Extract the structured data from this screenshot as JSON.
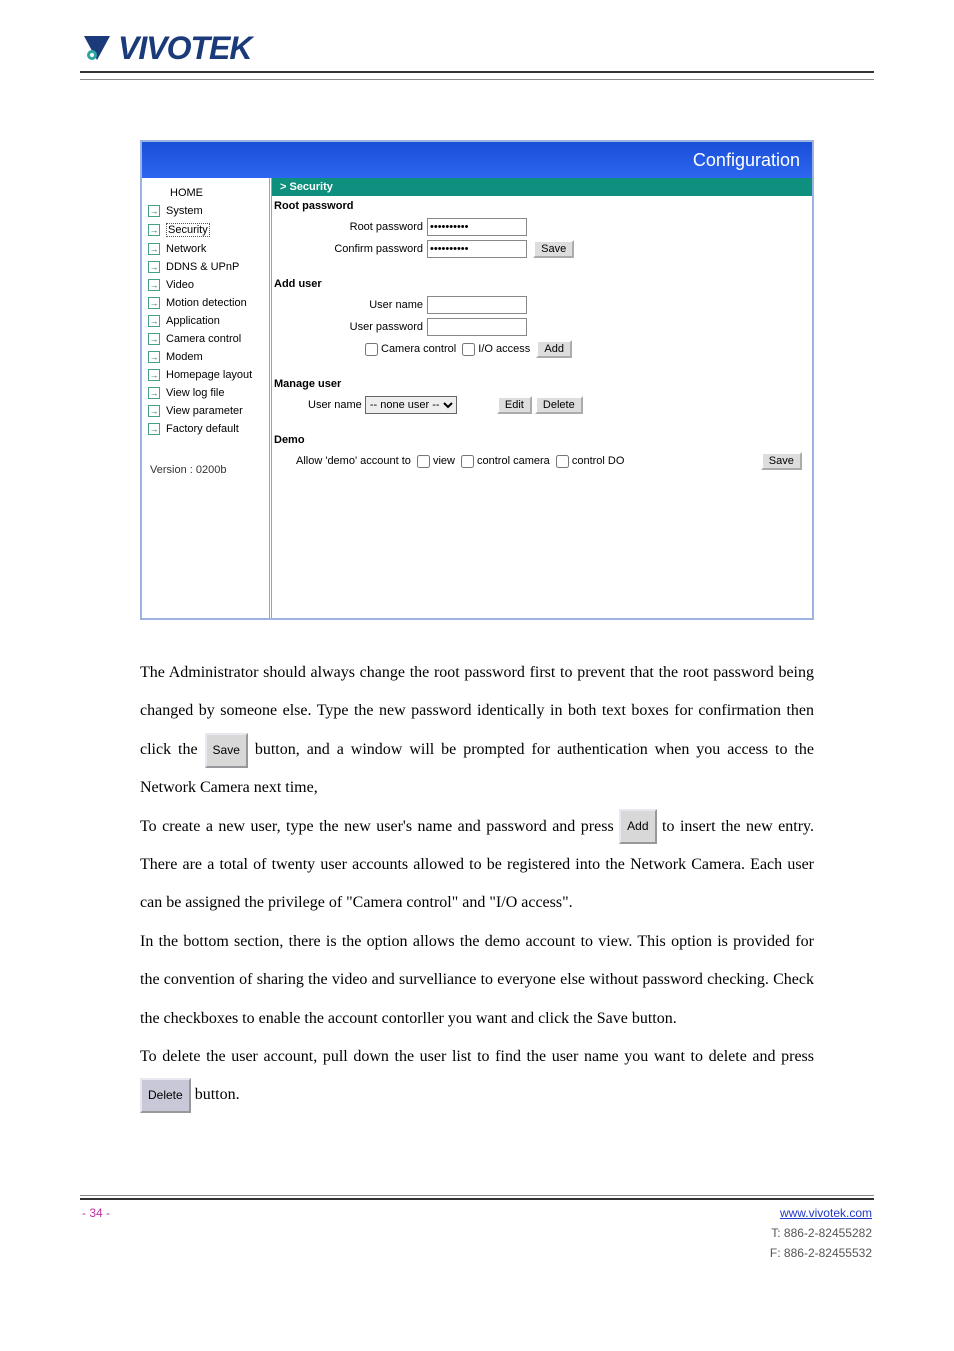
{
  "logo_text": "VIVOTEK",
  "window": {
    "title": "Configuration",
    "sidebar": {
      "home": "HOME",
      "items": [
        "System",
        "Security",
        "Network",
        "DDNS & UPnP",
        "Video",
        "Motion detection",
        "Application",
        "Camera control",
        "Modem",
        "Homepage layout",
        "View log file",
        "View parameter",
        "Factory default"
      ],
      "version": "Version : 0200b"
    },
    "breadcrumb": "> Security",
    "root_password": {
      "title": "Root password",
      "root_label": "Root password",
      "confirm_label": "Confirm password",
      "masked": "**********",
      "save": "Save"
    },
    "add_user": {
      "title": "Add user",
      "username_label": "User name",
      "userpass_label": "User password",
      "cam_label": "Camera control",
      "io_label": "I/O access",
      "add": "Add"
    },
    "manage_user": {
      "title": "Manage user",
      "username_label": "User name",
      "selected": "-- none user --",
      "edit": "Edit",
      "delete": "Delete"
    },
    "demo": {
      "title": "Demo",
      "prefix": "Allow 'demo' account to",
      "opt_view": "view",
      "opt_cam": "control camera",
      "opt_do": "control DO",
      "save": "Save"
    }
  },
  "body": {
    "btn_save": "Save",
    "btn_add": "Add",
    "btn_delete": "Delete",
    "p1a": "The Administrator should always change the root password first to prevent that the root password being changed by someone else. Type the new password identically in both text boxes for confirmation then click the ",
    "p1b": " button, and a window will be prompted for authentication when you access to the Network Camera next time,",
    "p2a": "To create a new user, type the new user's name and password and press ",
    "p2b": " to insert the new entry. There are a total of twenty user accounts allowed to be registered into the Network Camera. Each user can be assigned the privilege of \"Camera control\" and \"I/O access\".",
    "p3": "In the bottom section, there is the option allows the demo account to view. This option is provided for the convention of sharing the video and survelliance to everyone else without password checking. Check the checkboxes to enable the account contorller you want and click the Save button.",
    "p4a": "To delete the user account, pull down the user list to find the user name you want to delete and press ",
    "p4b": " button."
  },
  "footer": {
    "left": "- 34 -",
    "right_label": "www.vivotek.com",
    "tm": "T: 886-2-82455282",
    "fx": "F: 886-2-82455532"
  }
}
